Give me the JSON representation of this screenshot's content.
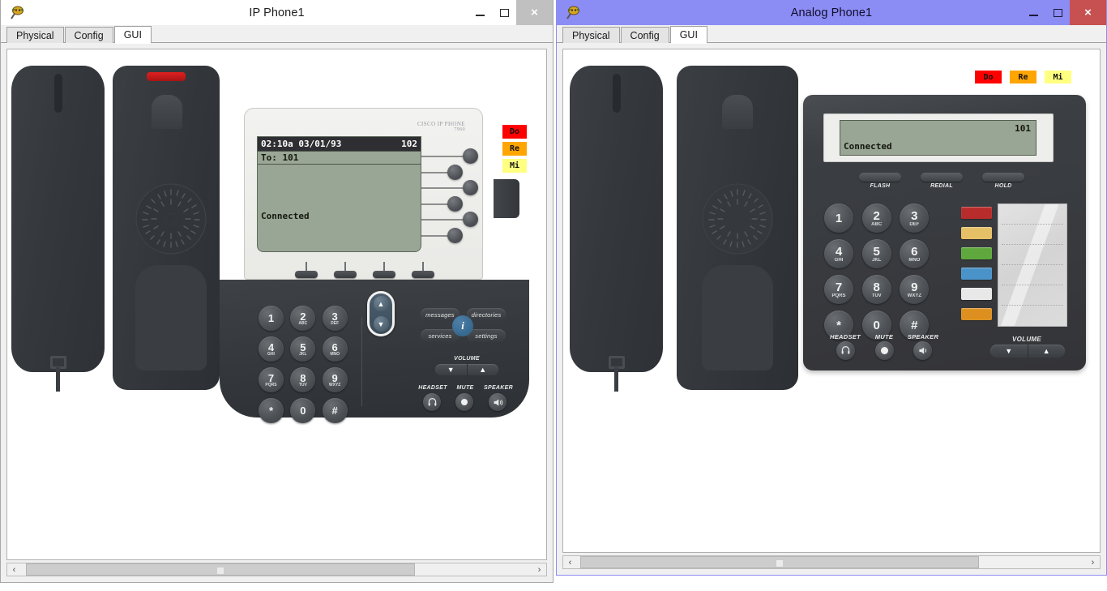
{
  "windows": [
    {
      "id": "ip-phone",
      "title": "IP Phone1",
      "active": false,
      "controls": {
        "minimize": "–",
        "maximize": "☐",
        "close": "×"
      },
      "tabs": [
        {
          "label": "Physical",
          "selected": false
        },
        {
          "label": "Config",
          "selected": false
        },
        {
          "label": "GUI",
          "selected": true
        }
      ],
      "scrollbar": {
        "left_arrow": "‹",
        "right_arrow": "›"
      },
      "phone": {
        "model": "ip-7960",
        "brand_line1": "CISCO IP PHONE",
        "brand_line2": "7960",
        "lcd": {
          "time": "02:10a 03/01/93",
          "extension": "102",
          "line_row": "To: 101",
          "status": "Connected"
        },
        "keypad": [
          {
            "digit": "1",
            "letters": ""
          },
          {
            "digit": "2",
            "letters": "ABC"
          },
          {
            "digit": "3",
            "letters": "DEF"
          },
          {
            "digit": "4",
            "letters": "GHI"
          },
          {
            "digit": "5",
            "letters": "JKL"
          },
          {
            "digit": "6",
            "letters": "MNO"
          },
          {
            "digit": "7",
            "letters": "PQRS"
          },
          {
            "digit": "8",
            "letters": "TUV"
          },
          {
            "digit": "9",
            "letters": "WXYZ"
          },
          {
            "digit": "*",
            "letters": ""
          },
          {
            "digit": "0",
            "letters": ""
          },
          {
            "digit": "#",
            "letters": ""
          }
        ],
        "feature_buttons": [
          {
            "label": "messages"
          },
          {
            "label": "directories"
          },
          {
            "label": "services"
          },
          {
            "label": "settings"
          }
        ],
        "info_button": "i",
        "volume_label": "VOLUME",
        "volume_down": "▼",
        "volume_up": "▲",
        "nav_up": "▲",
        "nav_down": "▼",
        "bottom_buttons": [
          {
            "label": "HEADSET",
            "icon": "headset-icon"
          },
          {
            "label": "MUTE",
            "icon": "mute-icon"
          },
          {
            "label": "SPEAKER",
            "icon": "speaker-icon"
          }
        ],
        "tone_buttons": [
          {
            "label": "Do",
            "color": "#ff0000"
          },
          {
            "label": "Re",
            "color": "#ffa500"
          },
          {
            "label": "Mi",
            "color": "#ffff80"
          }
        ]
      }
    },
    {
      "id": "analog-phone",
      "title": "Analog Phone1",
      "active": true,
      "controls": {
        "minimize": "–",
        "maximize": "☐",
        "close": "×"
      },
      "tabs": [
        {
          "label": "Physical",
          "selected": false
        },
        {
          "label": "Config",
          "selected": false
        },
        {
          "label": "GUI",
          "selected": true
        }
      ],
      "scrollbar": {
        "left_arrow": "‹",
        "right_arrow": "›"
      },
      "phone": {
        "model": "analog",
        "lcd": {
          "extension": "101",
          "status": "Connected"
        },
        "top_buttons": [
          {
            "label": "FLASH"
          },
          {
            "label": "REDIAL"
          },
          {
            "label": "HOLD"
          }
        ],
        "keypad": [
          {
            "digit": "1",
            "letters": ""
          },
          {
            "digit": "2",
            "letters": "ABC"
          },
          {
            "digit": "3",
            "letters": "DEF"
          },
          {
            "digit": "4",
            "letters": "GHI"
          },
          {
            "digit": "5",
            "letters": "JKL"
          },
          {
            "digit": "6",
            "letters": "MNO"
          },
          {
            "digit": "7",
            "letters": "PQRS"
          },
          {
            "digit": "8",
            "letters": "TUV"
          },
          {
            "digit": "9",
            "letters": "WXYZ"
          },
          {
            "digit": "*",
            "letters": ""
          },
          {
            "digit": "0",
            "letters": ""
          },
          {
            "digit": "#",
            "letters": ""
          }
        ],
        "speed_dial_colors": [
          "#b82c2c",
          "#e5c066",
          "#5fa83d",
          "#4a93c9",
          "#e8e8e8",
          "#dd9020"
        ],
        "bottom_buttons": [
          {
            "label": "HEADSET",
            "icon": "headset-icon"
          },
          {
            "label": "MUTE",
            "icon": "mute-icon"
          },
          {
            "label": "SPEAKER",
            "icon": "speaker-icon"
          }
        ],
        "volume_label": "VOLUME",
        "volume_down": "▼",
        "volume_up": "▲",
        "tone_buttons": [
          {
            "label": "Do",
            "color": "#ff0000"
          },
          {
            "label": "Re",
            "color": "#ffa500"
          },
          {
            "label": "Mi",
            "color": "#ffff80"
          }
        ]
      }
    }
  ]
}
